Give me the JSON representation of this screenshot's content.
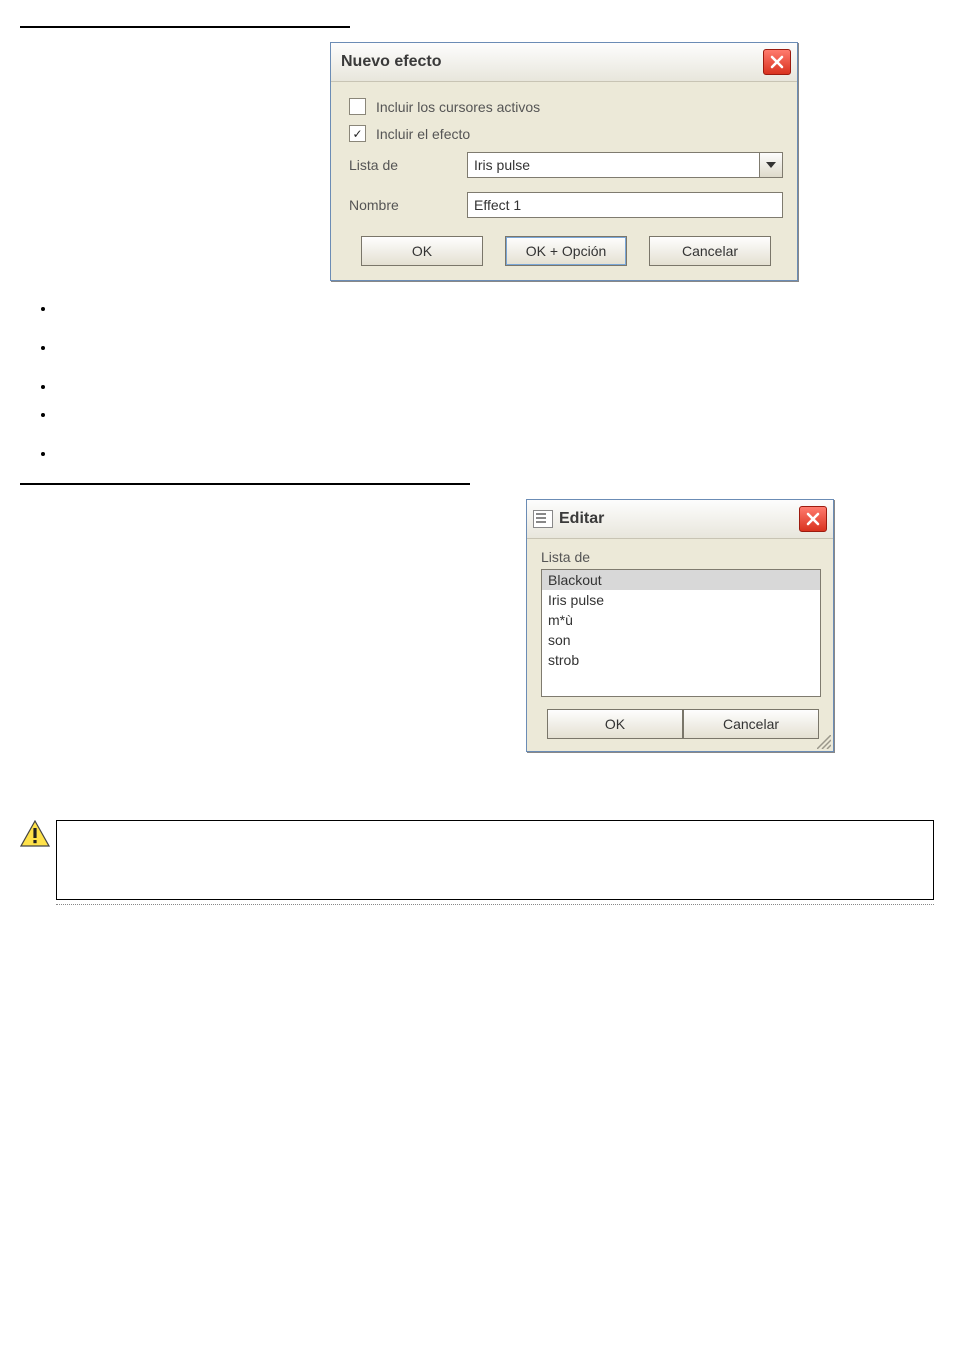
{
  "dialog1": {
    "title": "Nuevo efecto",
    "chk1_label": "Incluir los cursores activos",
    "chk1_checked": false,
    "chk2_label": "Incluir el efecto",
    "chk2_checked": true,
    "label_list": "Lista de",
    "combo_value": "Iris pulse",
    "label_name": "Nombre",
    "name_value": "Effect 1",
    "btn_ok": "OK",
    "btn_ok_option": "OK + Opción",
    "btn_cancel": "Cancelar"
  },
  "bullets": [
    "",
    "",
    "",
    "",
    ""
  ],
  "dialog2": {
    "title": "Editar",
    "label_list": "Lista de",
    "items": [
      "Blackout",
      "Iris pulse",
      "m*ù",
      "son",
      "strob"
    ],
    "selected_index": 0,
    "btn_ok": "OK",
    "btn_cancel": "Cancelar"
  },
  "warning_text": ""
}
